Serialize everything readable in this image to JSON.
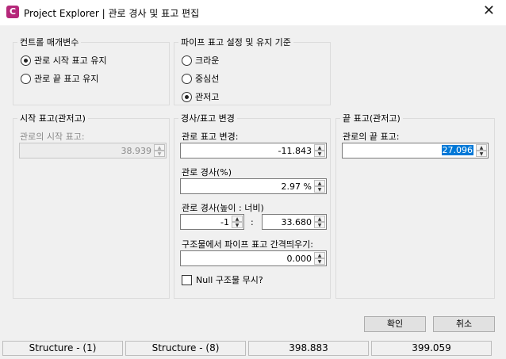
{
  "window": {
    "title": "Project Explorer | 관로 경사 및 표고 편집",
    "app_icon_letter": "C"
  },
  "control_params": {
    "legend": "컨트롤 매개변수",
    "options": [
      {
        "label": "관로 시작 표고 유지",
        "selected": true
      },
      {
        "label": "관로 끝 표고 유지",
        "selected": false
      }
    ]
  },
  "pipe_standard": {
    "legend": "파이프 표고 설정 및 유지 기준",
    "options": [
      {
        "label": "크라운",
        "selected": false
      },
      {
        "label": "중심선",
        "selected": false
      },
      {
        "label": "관저고",
        "selected": true
      }
    ]
  },
  "start_elev": {
    "legend": "시작 표고(관저고)",
    "field_label": "관로의 시작 표고:",
    "value": "38.939"
  },
  "slope": {
    "legend": "경사/표고 변경",
    "elev_change_label": "관로 표고 변경:",
    "elev_change_value": "-11.843",
    "slope_pct_label": "관로 경사(%)",
    "slope_pct_value": "2.97 %",
    "rise_run_label": "관로 경사(높이 : 너비)",
    "rise_value": "-1",
    "ratio_sep": ":",
    "run_value": "33.680",
    "offset_label": "구조물에서 파이프 표고 간격띄우기:",
    "offset_value": "0.000",
    "ignore_null_label": "Null 구조물 무시?",
    "ignore_null_checked": false
  },
  "end_elev": {
    "legend": "끝 표고(관저고)",
    "field_label": "관로의 끝 표고:",
    "value": "27.096"
  },
  "buttons": {
    "ok": "확인",
    "cancel": "취소"
  },
  "status_bar": [
    "Structure - (1)",
    "Structure - (8)",
    "398.883",
    "399.059"
  ],
  "icons": {
    "up": "▲",
    "down": "▼",
    "close": "✕"
  },
  "colors": {
    "accent": "#0078d7",
    "app_icon": "#b5287a"
  }
}
